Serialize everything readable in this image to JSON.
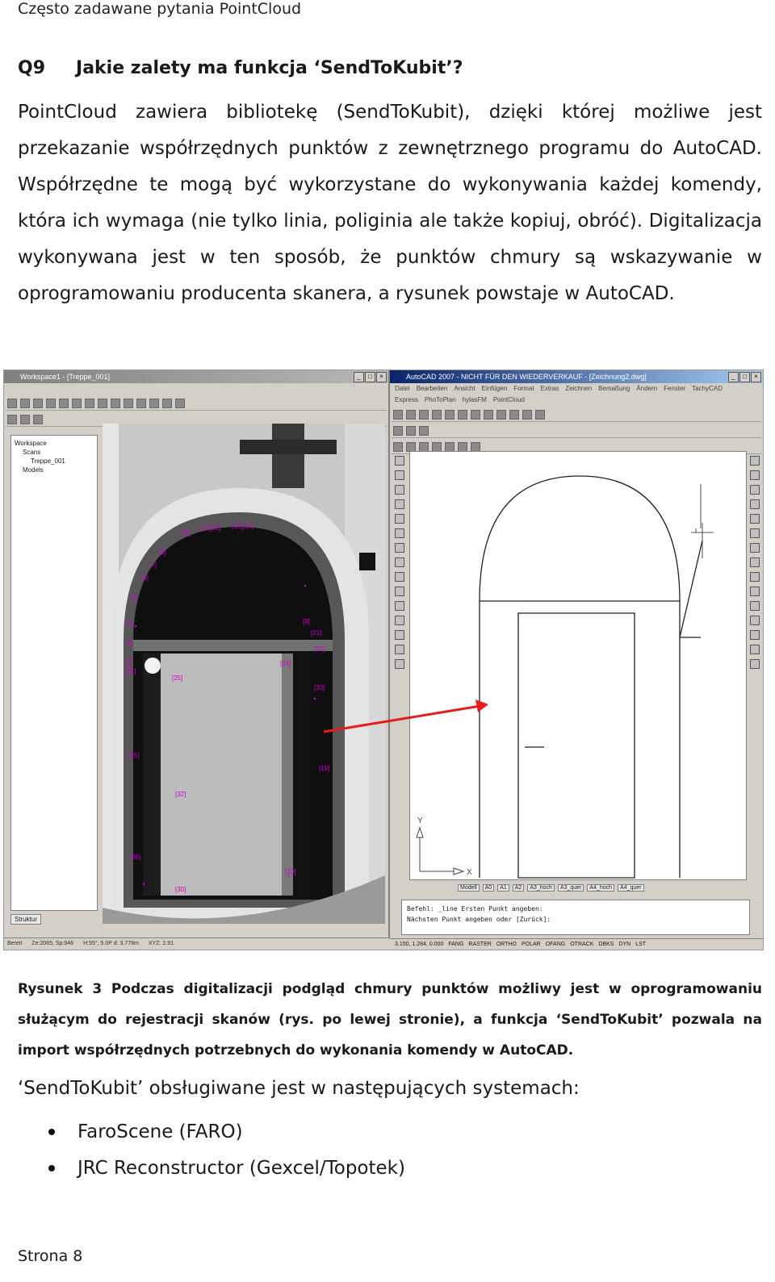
{
  "header": {
    "text": "Często zadawane pytania PointCloud"
  },
  "question": {
    "number": "Q9",
    "title": "Jakie zalety ma funkcja ‘SendToKubit’?"
  },
  "paragraph": "PointCloud zawiera bibliotekę (SendToKubit), dzięki której możliwe jest przekazanie współrzędnych punktów z zewnętrznego programu do AutoCAD. Współrzędne te mogą być wykorzystane do wykonywania każdej komendy, która ich wymaga (nie tylko linia, poliginia ale także kopiuj, obróć). Digitalizacja wykonywana jest w ten sposób, że punktów chmury są wskazywanie w oprogramowaniu producenta skanera, a rysunek powstaje w AutoCAD.",
  "figure": {
    "left_window": {
      "title": "Workspace1 - [Treppe_001]",
      "tree": [
        "Workspace",
        "Scans",
        "Treppe_001",
        "Models"
      ],
      "tab": "Struktur",
      "status": [
        "Bereit",
        "Ze:2065, Sp:946",
        "H:55°, 5.0P  d: 3.778m",
        "XYZ: 2.91"
      ]
    },
    "right_window": {
      "title": "AutoCAD 2007 - NICHT FÜR DEN WIEDERVERKAUF - [Zeichnung2.dwg]",
      "menu": [
        "Datei",
        "Bearbeiten",
        "Ansicht",
        "Einfügen",
        "Format",
        "Extras",
        "Zeichnen",
        "Bemaßung",
        "Ändern",
        "Fenster",
        "TachyCAD"
      ],
      "menu2": [
        "Express",
        "PhoToPlan",
        "hylasFM",
        "PointCloud"
      ],
      "layout_tabs": [
        "Modell",
        "A0",
        "A1",
        "A2",
        "A3_hoch",
        "A3_quer",
        "A4_hoch",
        "A4_quer"
      ],
      "command_lines": [
        "Befehl: _line Ersten Punkt angeben:",
        "Nächsten Punkt angeben oder [Zurück]:"
      ],
      "coords": "3.150, 1.284, 0.000",
      "status_buttons": [
        "FANG",
        "RASTER",
        "ORTHO",
        "POLAR",
        "OFANG",
        "OTRACK",
        "DBKS",
        "DYN",
        "LST"
      ],
      "axis_y": "Y",
      "axis_x": "X"
    }
  },
  "caption": "Rysunek 3 Podczas digitalizacji podgląd chmury punktów możliwy jest w oprogramowaniu służącym do rejestracji skanów (rys. po lewej stronie), a funkcja ‘SendToKubit’ pozwala na import współrzędnych potrzebnych do wykonania komendy w AutoCAD.",
  "systems_intro": "‘SendToKubit’ obsługiwane jest w następujących systemach:",
  "systems": [
    "FaroScene (FARO)",
    "JRC Reconstructor (Gexcel/Topotek)"
  ],
  "footer": "Strona 8",
  "colors": {
    "arrow": "#e41e1e",
    "markers": "#d200d2",
    "cad_title": "#0a246a"
  }
}
